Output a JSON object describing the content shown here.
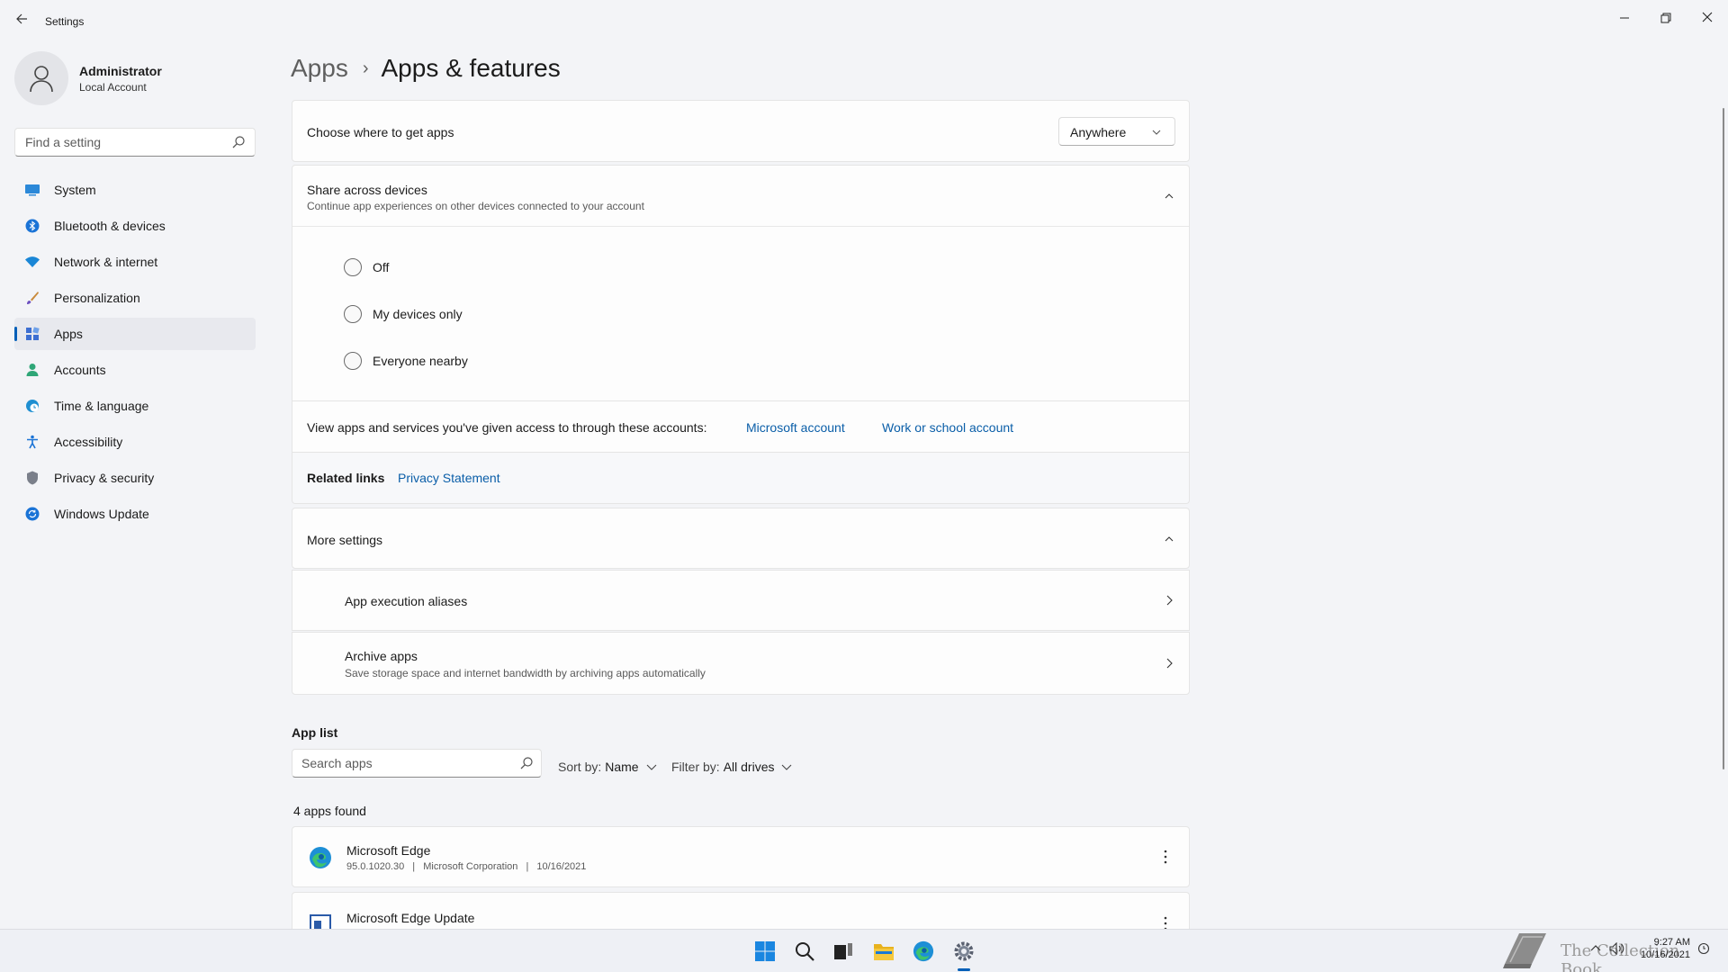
{
  "window": {
    "title": "Settings"
  },
  "profile": {
    "name": "Administrator",
    "account_type": "Local Account"
  },
  "sidebar": {
    "search_placeholder": "Find a setting",
    "items": [
      {
        "label": "System",
        "icon": "monitor-icon"
      },
      {
        "label": "Bluetooth & devices",
        "icon": "bluetooth-icon"
      },
      {
        "label": "Network & internet",
        "icon": "wifi-icon"
      },
      {
        "label": "Personalization",
        "icon": "brush-icon"
      },
      {
        "label": "Apps",
        "icon": "apps-icon",
        "active": true
      },
      {
        "label": "Accounts",
        "icon": "person-icon"
      },
      {
        "label": "Time & language",
        "icon": "globe-clock-icon"
      },
      {
        "label": "Accessibility",
        "icon": "accessibility-icon"
      },
      {
        "label": "Privacy & security",
        "icon": "shield-icon"
      },
      {
        "label": "Windows Update",
        "icon": "update-icon"
      }
    ]
  },
  "breadcrumb": {
    "parent": "Apps",
    "separator": "›",
    "current": "Apps & features"
  },
  "choose_apps": {
    "label": "Choose where to get apps",
    "selected": "Anywhere"
  },
  "share": {
    "title": "Share across devices",
    "subtitle": "Continue app experiences on other devices connected to your account",
    "options": [
      "Off",
      "My devices only",
      "Everyone nearby"
    ]
  },
  "accounts_access": {
    "text": "View apps and services you've given access to through these accounts:",
    "link1": "Microsoft account",
    "link2": "Work or school account"
  },
  "related": {
    "label": "Related links",
    "link": "Privacy Statement"
  },
  "more_settings": {
    "title": "More settings",
    "items": [
      {
        "title": "App execution aliases",
        "subtitle": ""
      },
      {
        "title": "Archive apps",
        "subtitle": "Save storage space and internet bandwidth by archiving apps automatically"
      }
    ]
  },
  "app_list": {
    "title": "App list",
    "search_placeholder": "Search apps",
    "sort_label": "Sort by:",
    "sort_value": "Name",
    "filter_label": "Filter by:",
    "filter_value": "All drives",
    "count_text": "4 apps found",
    "apps": [
      {
        "name": "Microsoft Edge",
        "version": "95.0.1020.30",
        "publisher": "Microsoft Corporation",
        "date": "10/16/2021",
        "sep": "|"
      },
      {
        "name": "Microsoft Edge Update",
        "version": "",
        "publisher": "",
        "date": "",
        "sep": ""
      }
    ]
  },
  "taskbar": {
    "icons": [
      "start-icon",
      "search-icon",
      "task-view-icon",
      "file-explorer-icon",
      "edge-icon",
      "settings-icon"
    ],
    "watermark": "The Collection Book",
    "clock_time": "9:27 AM",
    "clock_date": "10/16/2021"
  },
  "colors": {
    "accent": "#005fb8",
    "link": "#0a5ea8"
  }
}
